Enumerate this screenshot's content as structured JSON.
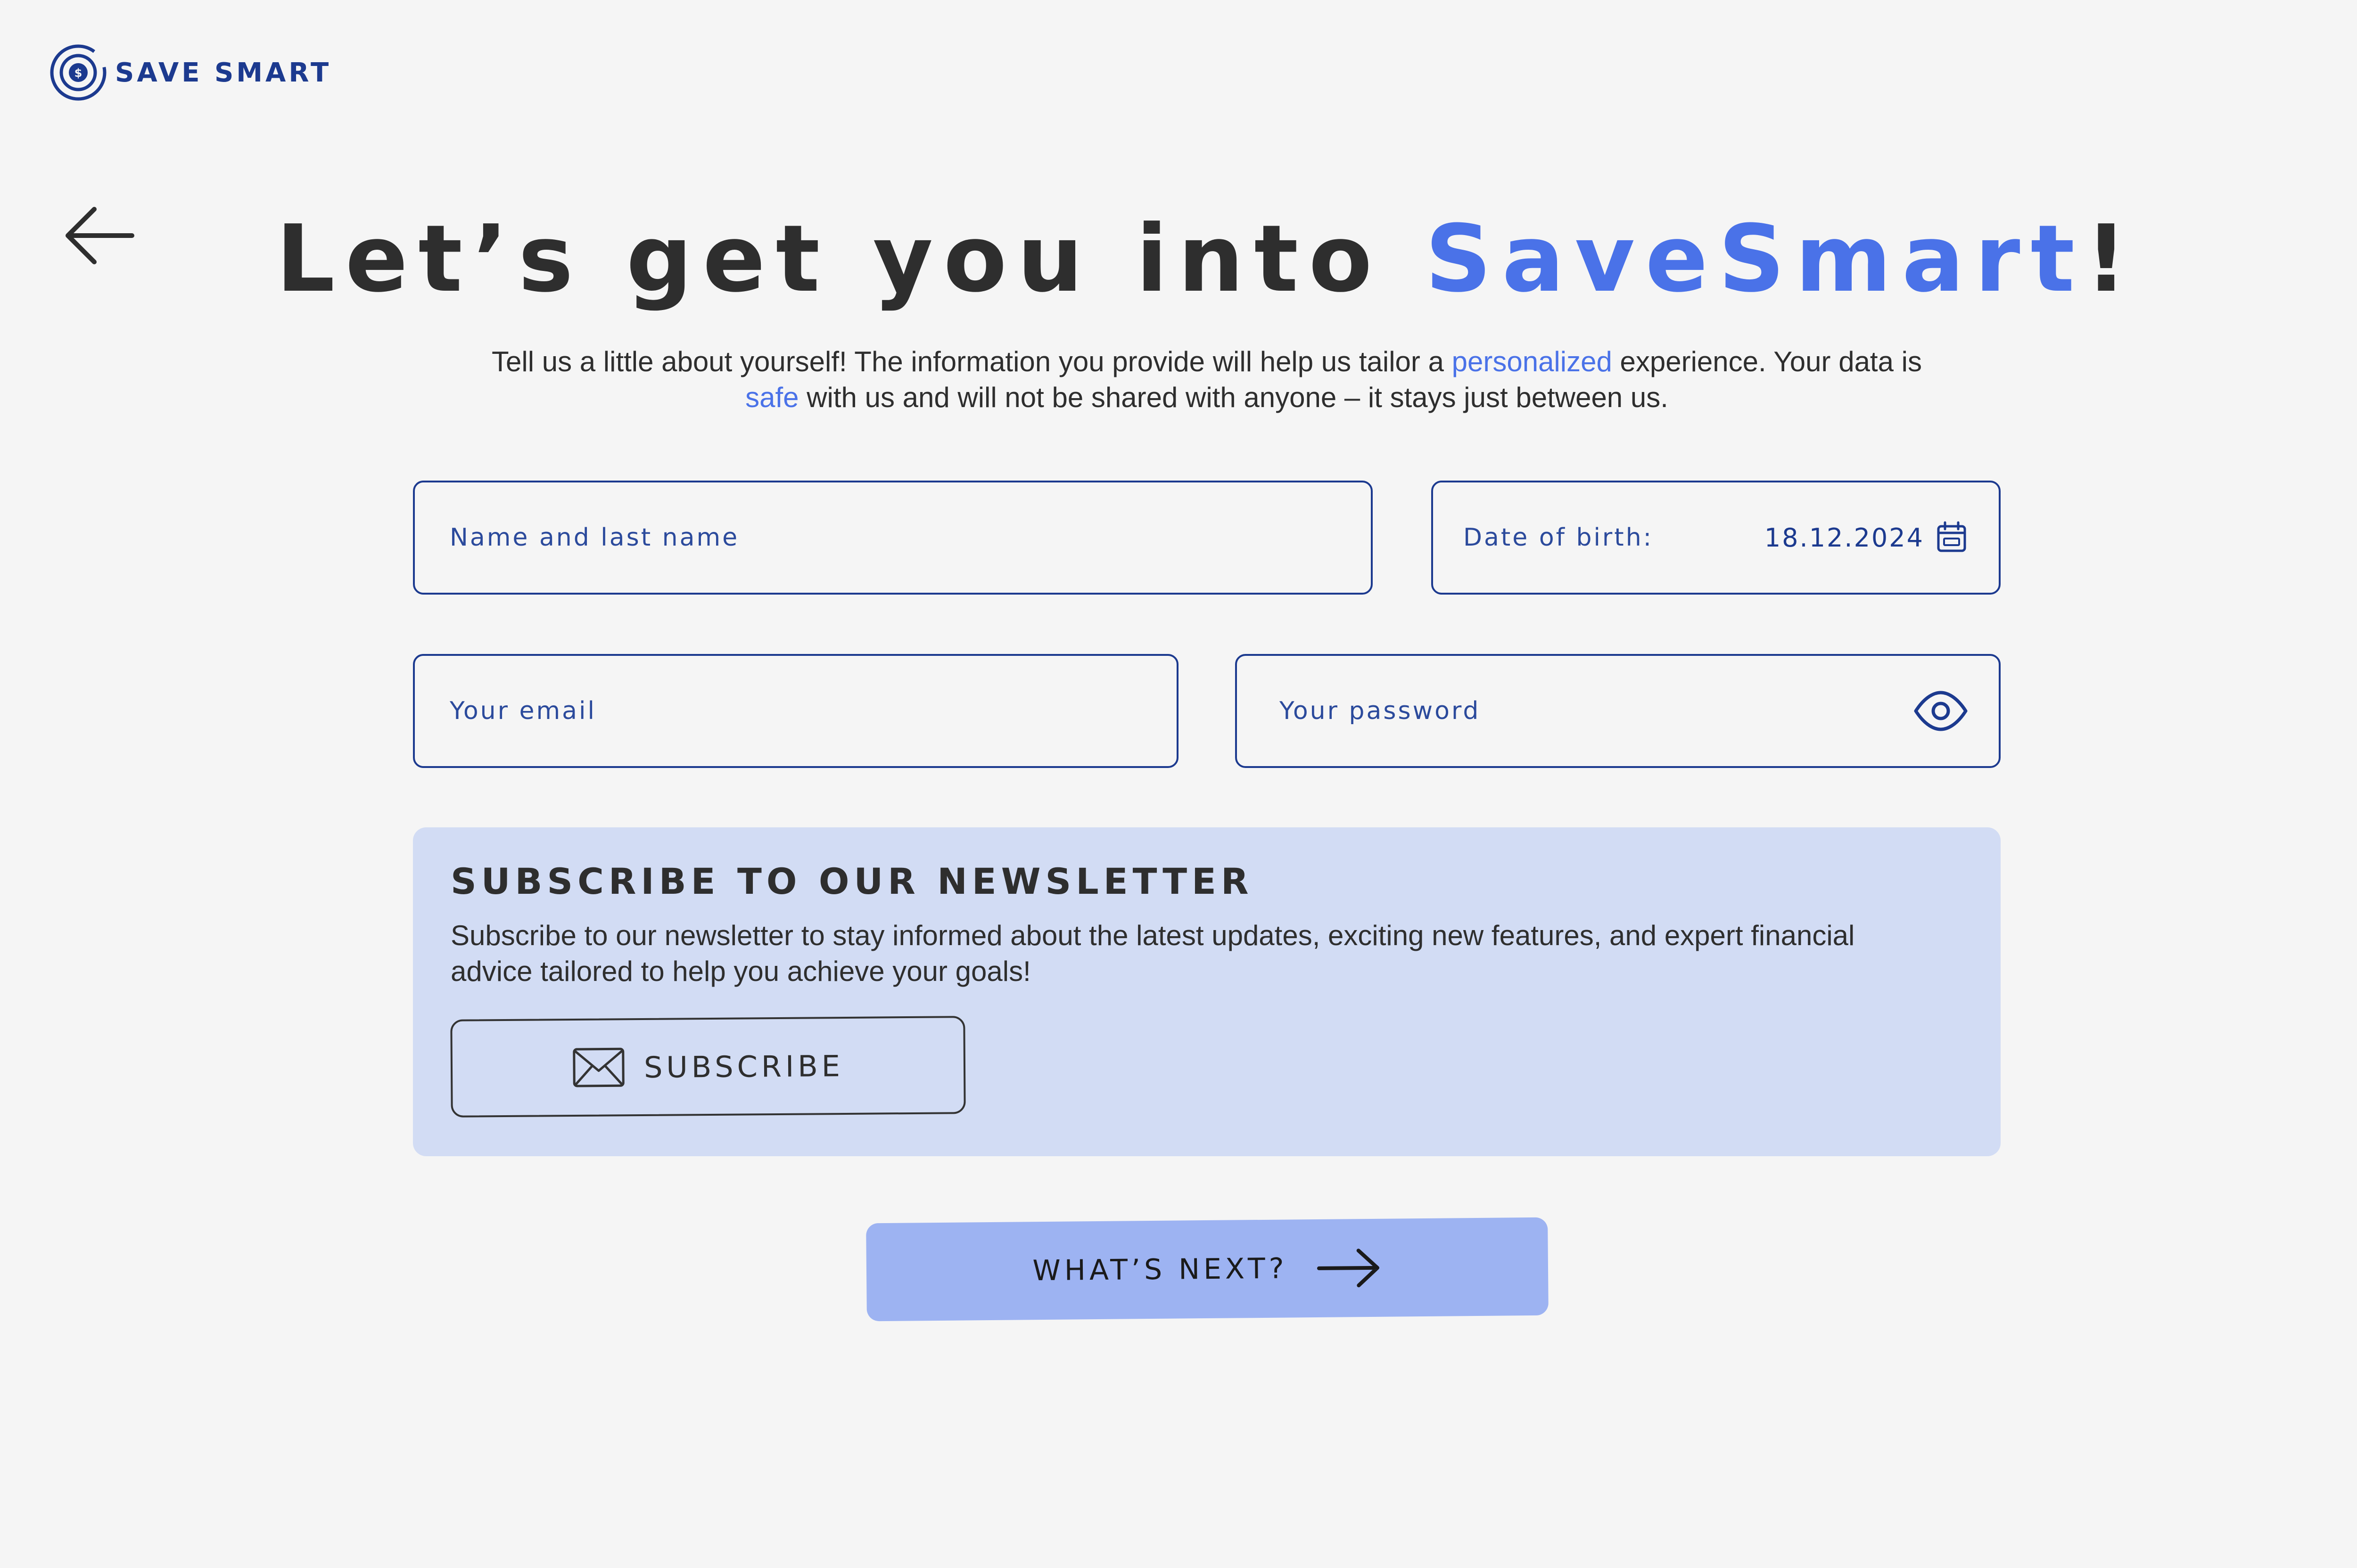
{
  "logo": {
    "text": "SAVE SMART",
    "icon": "coin-target-icon"
  },
  "nav": {
    "back_icon": "arrow-left-icon"
  },
  "heading": {
    "prefix": "Let’s get you into ",
    "brand": "SaveSmart",
    "suffix": "!"
  },
  "intro": {
    "part1": "Tell us a little about yourself! The information you provide will help us tailor a ",
    "highlight1": "personalized",
    "part2": " experience. Your data is ",
    "highlight2": "safe",
    "part3": " with us and will not be shared with anyone – it stays just between us."
  },
  "form": {
    "name_placeholder": "Name and last name",
    "dob_label": "Date of birth:",
    "dob_value": "18.12.2024",
    "email_placeholder": "Your email",
    "password_placeholder": "Your password"
  },
  "newsletter": {
    "title": "SUBSCRIBE TO OUR NEWSLETTER",
    "text": "Subscribe to our newsletter to stay informed about the latest updates, exciting new features, and expert financial advice tailored to help you achieve your goals!",
    "button_label": "SUBSCRIBE",
    "button_icon": "envelope-icon"
  },
  "next_button": {
    "label": "WHAT’S NEXT?",
    "icon": "arrow-right-icon"
  },
  "colors": {
    "background": "#f5f5f5",
    "brand_dark": "#1c3a8f",
    "accent": "#4a72e8",
    "newsletter_bg": "#d2dcf4",
    "next_button_bg": "#9db3f2",
    "text": "#2e2e2e"
  }
}
